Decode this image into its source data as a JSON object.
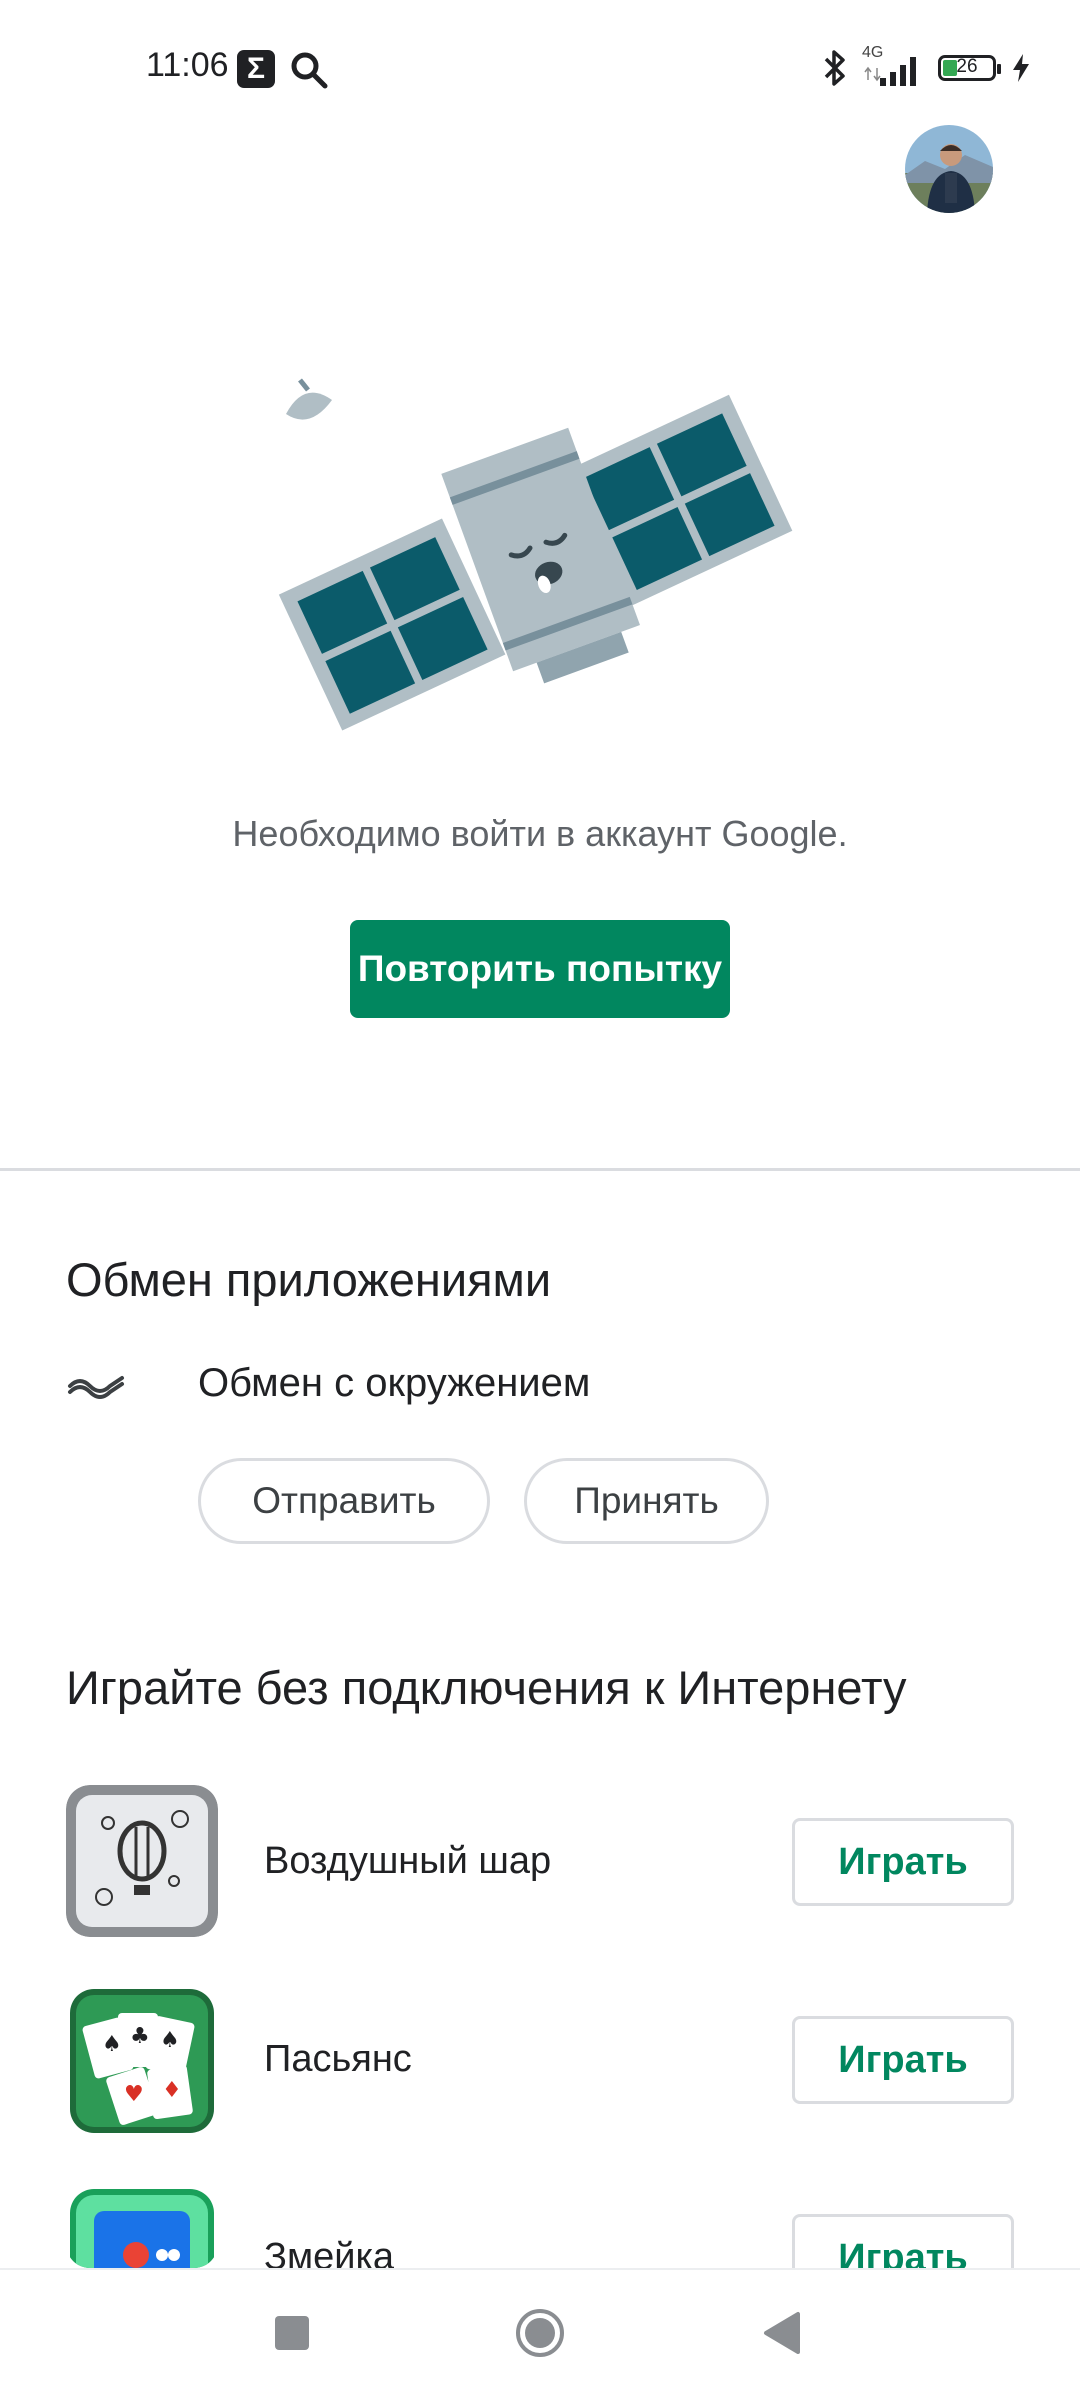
{
  "status_bar": {
    "time": "11:06",
    "notification_icon": "Σ",
    "network": "4G",
    "battery": "26",
    "battery_percent": 26
  },
  "main": {
    "signin_message": "Необходимо войти в аккаунт Google.",
    "retry_label": "Повторить попытку"
  },
  "share": {
    "title": "Обмен приложениями",
    "nearby_label": "Обмен с окружением",
    "send_label": "Отправить",
    "receive_label": "Принять"
  },
  "games": {
    "title": "Играйте без подключения к Интернету",
    "items": [
      {
        "name": "Воздушный шар",
        "play_label": "Играть"
      },
      {
        "name": "Пасьянс",
        "play_label": "Играть"
      },
      {
        "name": "Змейка",
        "play_label": "Играть"
      }
    ]
  },
  "colors": {
    "accent": "#01875f",
    "satellite_panel": "#0b5b6a",
    "satellite_body": "#b0bec5"
  }
}
